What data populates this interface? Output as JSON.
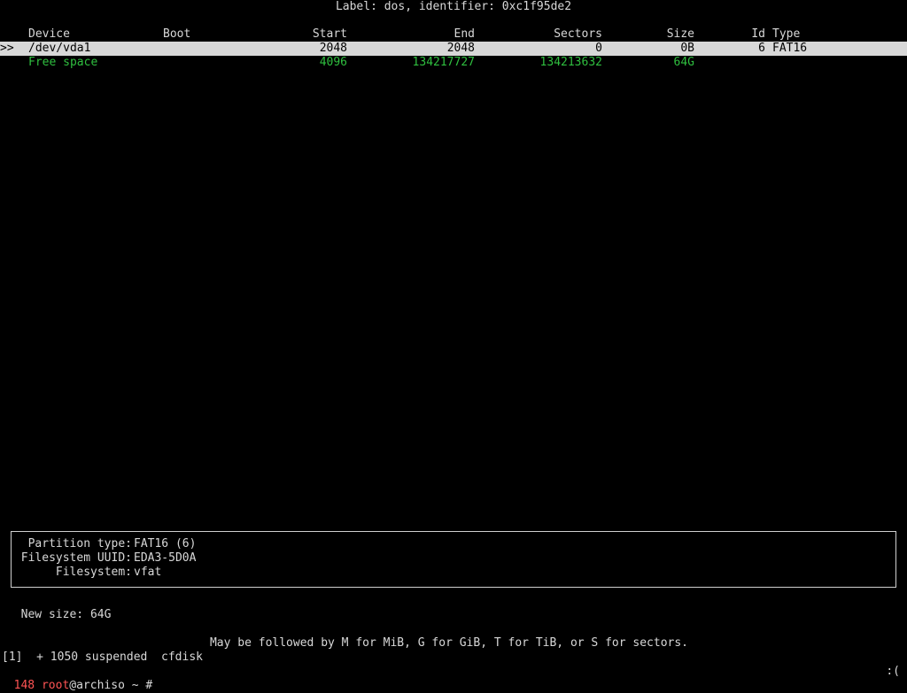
{
  "header": {
    "label": "Label: dos, identifier: 0xc1f95de2"
  },
  "columns": {
    "device": "Device",
    "boot": "Boot",
    "start": "Start",
    "end": "End",
    "sectors": "Sectors",
    "size": "Size",
    "id": "Id",
    "type": "Type"
  },
  "rows": [
    {
      "marker": ">>",
      "device": "/dev/vda1",
      "boot": "",
      "start": "2048",
      "end": "2048",
      "sectors": "0",
      "size": "0B",
      "id": "6",
      "type": "FAT16",
      "selected": true
    },
    {
      "marker": "",
      "device": "Free space",
      "boot": "",
      "start": "4096",
      "end": "134217727",
      "sectors": "134213632",
      "size": "64G",
      "id": "",
      "type": "",
      "selected": false
    }
  ],
  "info": {
    "partition_type_label": "Partition type:",
    "partition_type_value": "FAT16 (6)",
    "fs_uuid_label": "Filesystem UUID:",
    "fs_uuid_value": "EDA3-5D0A",
    "filesystem_label": "Filesystem:",
    "filesystem_value": "vfat"
  },
  "input": {
    "prompt": "New size:",
    "value": "64G"
  },
  "hint": "May be followed by M for MiB, G for GiB, T for TiB, or S for sectors.",
  "shell": {
    "jobs_line": "[1]  + 1050 suspended  cfdisk",
    "prompt_number": "148",
    "prompt_user": "root",
    "prompt_host": "@archiso ~ #",
    "right_status": ":("
  },
  "colors": {
    "background": "#000000",
    "text": "#d8d8d8",
    "selected_bg": "#d8d8d8",
    "free_space": "#2fbf3f",
    "prompt_red": "#ff5454"
  }
}
